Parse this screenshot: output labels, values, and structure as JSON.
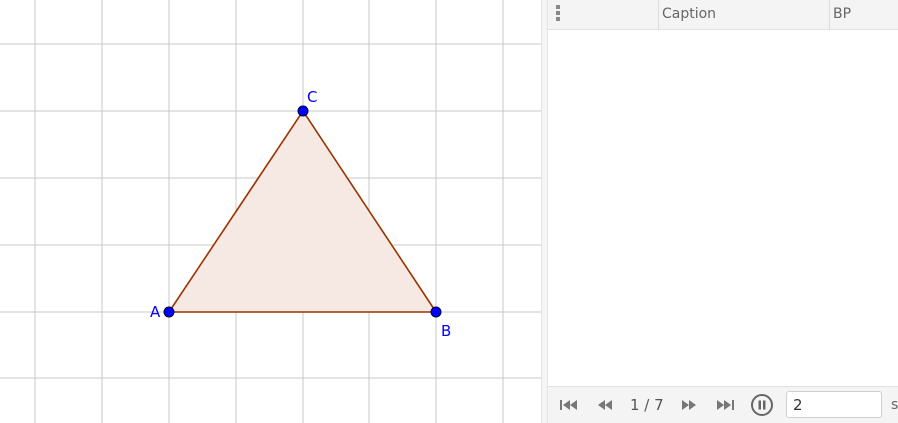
{
  "graphics": {
    "points": [
      {
        "label": "A",
        "color": "#0000ff"
      },
      {
        "label": "B",
        "color": "#0000ff"
      },
      {
        "label": "C",
        "color": "#0000ff"
      }
    ],
    "triangle": {
      "stroke": "#993300",
      "fill": "#f6e8e2"
    },
    "grid_color": "#c8c8c8"
  },
  "table": {
    "columns": [
      "Caption",
      "BP"
    ]
  },
  "navigation": {
    "page": "1 / 7",
    "speed_value": "2",
    "speed_unit": "s",
    "icons": [
      "skip-first-icon",
      "rewind-icon",
      "fast-forward-icon",
      "skip-last-icon",
      "pause-icon"
    ]
  }
}
